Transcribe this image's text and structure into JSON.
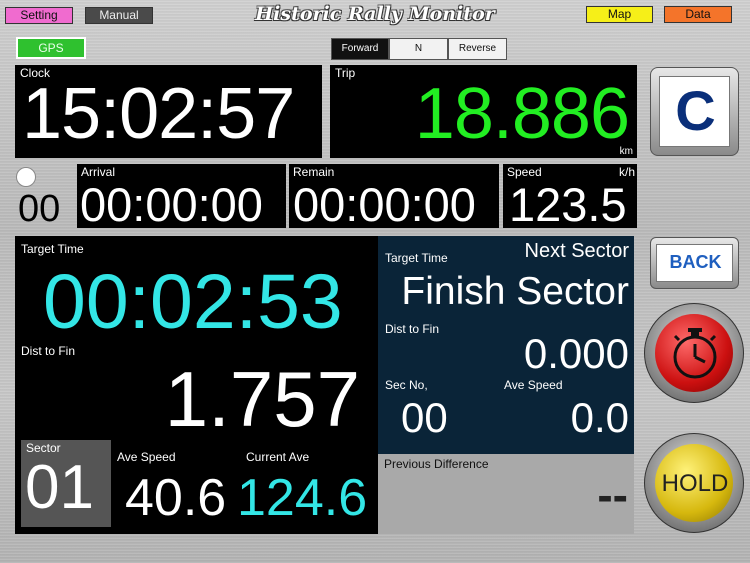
{
  "topbar": {
    "title": "Historic Rally Monitor",
    "setting": "Setting",
    "manual": "Manual",
    "map": "Map",
    "data": "Data"
  },
  "gps": "GPS",
  "direction": {
    "forward": "Forward",
    "neutral": "N",
    "reverse": "Reverse"
  },
  "clock": {
    "label": "Clock",
    "value": "15:02:57"
  },
  "trip": {
    "label": "Trip",
    "value": "18.886",
    "unit": "km"
  },
  "clear_label": "C",
  "counter": "00",
  "arrival": {
    "label": "Arrival",
    "value": "00:00:00"
  },
  "remain": {
    "label": "Remain",
    "value": "00:00:00"
  },
  "speed": {
    "label": "Speed",
    "unit": "k/h",
    "value": "123.5"
  },
  "left_panel": {
    "target_time_label": "Target Time",
    "target_time": "00:02:53",
    "dist_label": "Dist to Fin",
    "dist": "1.757",
    "sector_label": "Sector",
    "sector": "01",
    "ave_speed_label": "Ave Speed",
    "ave_speed": "40.6",
    "current_ave_label": "Current Ave",
    "current_ave": "124.6"
  },
  "right_panel": {
    "target_time_label": "Target Time",
    "next_sector_label": "Next Sector",
    "sector_name": "Finish Sector",
    "dist_label": "Dist to Fin",
    "dist": "0.000",
    "sec_no_label": "Sec No,",
    "sec_no": "00",
    "ave_speed_label": "Ave Speed",
    "ave_speed": "0.0"
  },
  "prev_diff": {
    "label": "Previous Difference",
    "value": "--"
  },
  "back_label": "BACK",
  "hold_label": "HOLD",
  "colors": {
    "green": "#22ee22",
    "cyan": "#33e6e6",
    "navy": "#0a2438",
    "blue_c": "#0a2f7a"
  }
}
